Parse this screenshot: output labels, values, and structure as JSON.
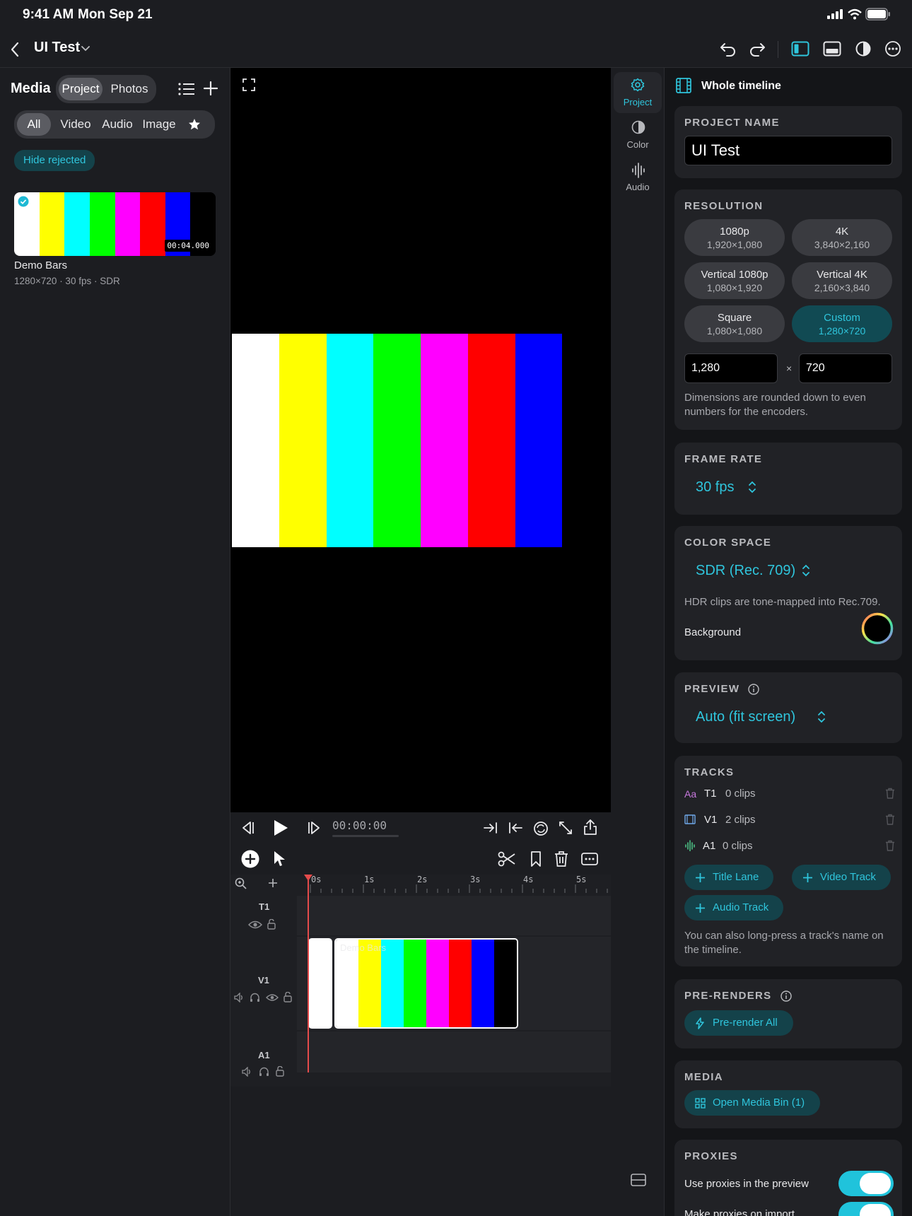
{
  "status_bar": {
    "time": "9:41 AM",
    "date": "Mon Sep 21"
  },
  "nav": {
    "project_title": "UI Test"
  },
  "media_panel": {
    "title": "Media",
    "source_tabs": [
      "Project",
      "Photos"
    ],
    "filters": [
      "All",
      "Video",
      "Audio",
      "Image"
    ],
    "hide_rejected": "Hide rejected",
    "clip": {
      "duration": "00:04.000",
      "name": "Demo Bars",
      "meta": "1280×720 · 30 fps · SDR"
    }
  },
  "bar_colors": [
    "#ffffff",
    "#ffff00",
    "#00ffff",
    "#00ff00",
    "#ff00ff",
    "#ff0000",
    "#0000ff",
    "#000000"
  ],
  "transport": {
    "timecode": "00:00:00"
  },
  "timeline": {
    "ticks": [
      "0s",
      "1s",
      "2s",
      "3s",
      "4s",
      "5s"
    ],
    "tracks": [
      "T1",
      "V1",
      "A1"
    ],
    "clip_label": "Demo Bars"
  },
  "inspector_tabs": [
    {
      "label": "Project"
    },
    {
      "label": "Color"
    },
    {
      "label": "Audio"
    }
  ],
  "inspector": {
    "header": "Whole timeline",
    "project_name": {
      "heading": "PROJECT NAME",
      "value": "UI Test"
    },
    "resolution": {
      "heading": "RESOLUTION",
      "presets": [
        {
          "name": "1080p",
          "dims": "1,920×1,080"
        },
        {
          "name": "4K",
          "dims": "3,840×2,160"
        },
        {
          "name": "Vertical 1080p",
          "dims": "1,080×1,920"
        },
        {
          "name": "Vertical 4K",
          "dims": "2,160×3,840"
        },
        {
          "name": "Square",
          "dims": "1,080×1,080"
        },
        {
          "name": "Custom",
          "dims": "1,280×720"
        }
      ],
      "width": "1,280",
      "times": "×",
      "height": "720",
      "hint": "Dimensions are rounded down to even numbers for the encoders."
    },
    "frame_rate": {
      "heading": "FRAME RATE",
      "value": "30 fps"
    },
    "color_space": {
      "heading": "COLOR SPACE",
      "value": "SDR (Rec. 709)",
      "hint": "HDR clips are tone-mapped into Rec.709.",
      "background_label": "Background"
    },
    "preview": {
      "heading": "PREVIEW",
      "value": "Auto (fit screen)"
    },
    "tracks": {
      "heading": "TRACKS",
      "rows": [
        {
          "icon": "Aa",
          "name": "T1",
          "count": "0 clips"
        },
        {
          "icon": "film",
          "name": "V1",
          "count": "2 clips"
        },
        {
          "icon": "wave",
          "name": "A1",
          "count": "0 clips"
        }
      ],
      "add_title": "Title Lane",
      "add_video": "Video Track",
      "add_audio": "Audio Track",
      "hint": "You can also long-press a track's name on the timeline."
    },
    "pre_renders": {
      "heading": "PRE-RENDERS",
      "button": "Pre-render All"
    },
    "media": {
      "heading": "MEDIA",
      "button": "Open Media Bin (1)"
    },
    "proxies": {
      "heading": "PROXIES",
      "use_label": "Use proxies in the preview",
      "make_label": "Make proxies on import"
    }
  }
}
